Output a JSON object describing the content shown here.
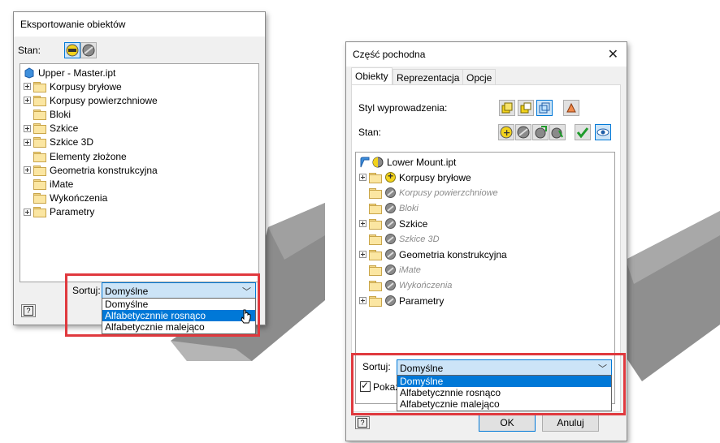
{
  "left_dialog": {
    "title": "Eksportowanie obiektów",
    "state_label": "Stan:",
    "tree": {
      "root": "Upper - Master.ipt",
      "items": [
        {
          "label": "Korpusy bryłowe",
          "expandable": true
        },
        {
          "label": "Korpusy powierzchniowe",
          "expandable": true
        },
        {
          "label": "Bloki",
          "expandable": false
        },
        {
          "label": "Szkice",
          "expandable": true
        },
        {
          "label": "Szkice 3D",
          "expandable": true
        },
        {
          "label": "Elementy złożone",
          "expandable": false
        },
        {
          "label": "Geometria konstrukcyjna",
          "expandable": true
        },
        {
          "label": "iMate",
          "expandable": false
        },
        {
          "label": "Wykończenia",
          "expandable": false
        },
        {
          "label": "Parametry",
          "expandable": true
        }
      ]
    },
    "sort": {
      "label": "Sortuj:",
      "value": "Domyślne",
      "options": [
        "Domyślne",
        "Alfabetycznnie rosnąco",
        "Alfabetycznie malejąco"
      ],
      "highlighted": "Alfabetycznnie rosnąco"
    },
    "help": "?"
  },
  "right_dialog": {
    "title": "Część pochodna",
    "close": "✕",
    "tabs": [
      "Obiekty",
      "Reprezentacja",
      "Opcje"
    ],
    "style_label": "Styl wyprowadzenia:",
    "state_label": "Stan:",
    "tree": {
      "root": "Lower Mount.ipt",
      "items": [
        {
          "label": "Korpusy bryłowe",
          "expandable": true,
          "status": "yellow",
          "style": "normal"
        },
        {
          "label": "Korpusy powierzchniowe",
          "expandable": false,
          "status": "gray",
          "style": "italic"
        },
        {
          "label": "Bloki",
          "expandable": false,
          "status": "gray",
          "style": "italic"
        },
        {
          "label": "Szkice",
          "expandable": true,
          "status": "gray",
          "style": "normal"
        },
        {
          "label": "Szkice 3D",
          "expandable": false,
          "status": "gray",
          "style": "italic"
        },
        {
          "label": "Geometria konstrukcyjna",
          "expandable": true,
          "status": "gray",
          "style": "normal"
        },
        {
          "label": "iMate",
          "expandable": false,
          "status": "gray",
          "style": "italic"
        },
        {
          "label": "Wykończenia",
          "expandable": false,
          "status": "gray",
          "style": "italic"
        },
        {
          "label": "Parametry",
          "expandable": true,
          "status": "gray",
          "style": "normal"
        }
      ]
    },
    "sort": {
      "label": "Sortuj:",
      "value": "Domyślne",
      "options": [
        "Domyślne",
        "Alfabetycznnie rosnąco",
        "Alfabetycznie malejąco"
      ],
      "highlighted": "Domyślne"
    },
    "show_checkbox_label": "Pokaż",
    "ok": "OK",
    "cancel": "Anuluj",
    "help": "?"
  },
  "colors": {
    "highlight": "#0078d7",
    "callout_red": "#e0393e",
    "combo_bg": "#cce4f7"
  }
}
